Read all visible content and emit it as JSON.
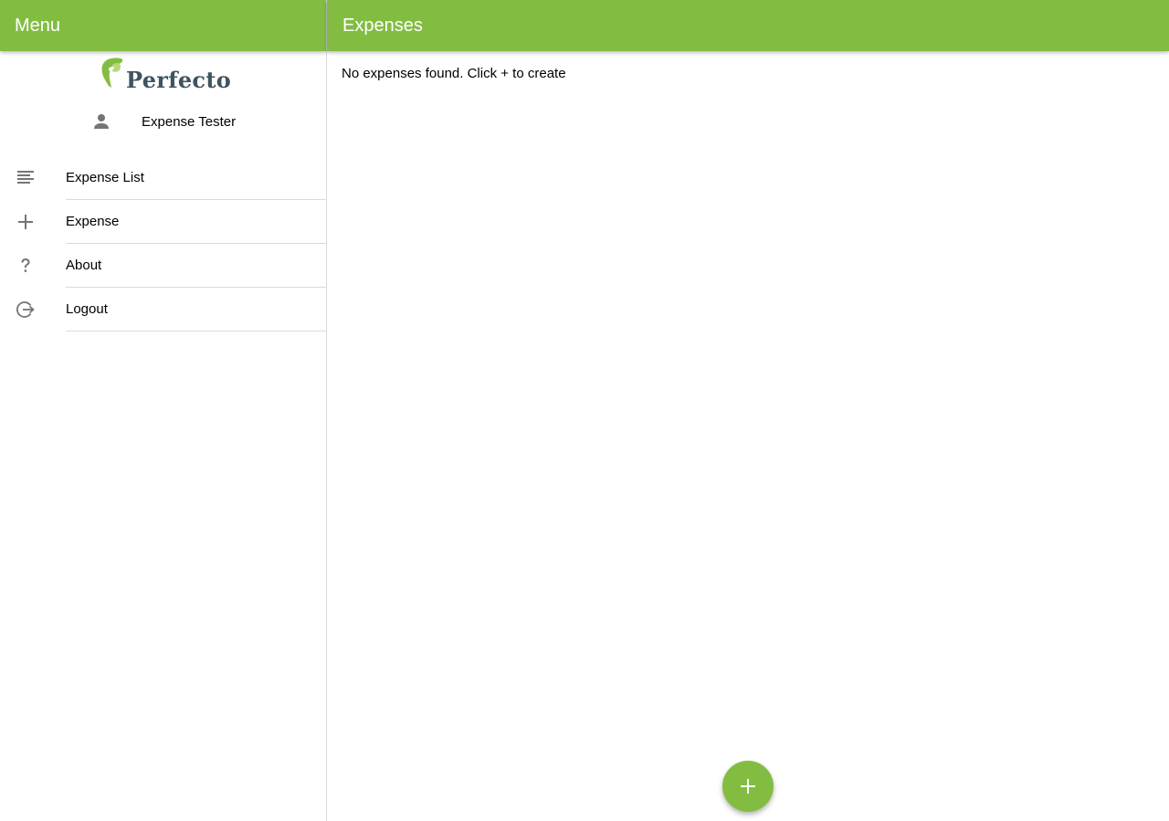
{
  "sidebar": {
    "header_title": "Menu",
    "logo_text": "Perfecto",
    "user_name": "Expense Tester",
    "items": [
      {
        "label": "Expense List",
        "icon": "list-icon"
      },
      {
        "label": "Expense",
        "icon": "plus-icon"
      },
      {
        "label": "About",
        "icon": "help-icon"
      },
      {
        "label": "Logout",
        "icon": "logout-icon"
      }
    ]
  },
  "main": {
    "header_title": "Expenses",
    "empty_message": "No expenses found. Click + to create",
    "fab_icon": "add-icon"
  },
  "colors": {
    "accent": "#82bd42",
    "logo_text": "#3f5460",
    "icon": "#757575"
  }
}
